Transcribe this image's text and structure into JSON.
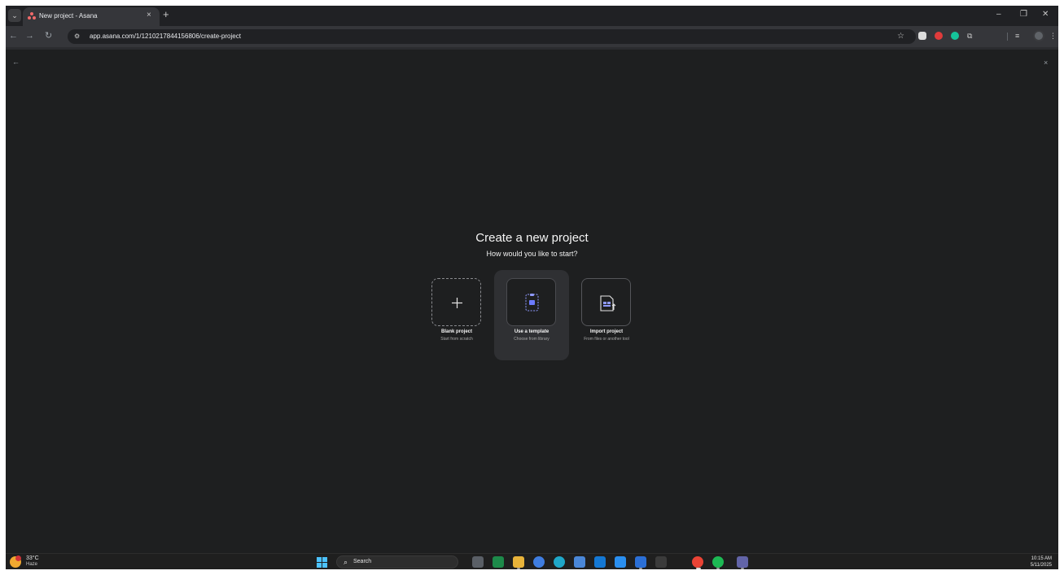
{
  "browser": {
    "tab_title": "New project - Asana",
    "tab_close": "×",
    "new_tab": "+",
    "tab_menu": "⌄",
    "url": "app.asana.com/1/1210217844156806/create-project",
    "window_controls": {
      "minimize": "–",
      "restore": "❐",
      "close": "✕"
    }
  },
  "page": {
    "back": "←",
    "close": "×",
    "heading": "Create a new project",
    "subheading": "How would you like to start?",
    "options": [
      {
        "title": "Blank project",
        "desc": "Start from scratch",
        "icon": "plus-icon"
      },
      {
        "title": "Use a template",
        "desc": "Choose from library",
        "icon": "template-icon"
      },
      {
        "title": "Import project",
        "desc": "From files or another tool",
        "icon": "import-icon"
      }
    ]
  },
  "taskbar": {
    "weather_temp": "33°C",
    "weather_desc": "Haze",
    "search_placeholder": "Search",
    "time": "10:15 AM",
    "date": "5/11/2025"
  },
  "colors": {
    "background": "#1e1f20",
    "accent": "#6c7bff",
    "asana": "#f06a6a"
  }
}
